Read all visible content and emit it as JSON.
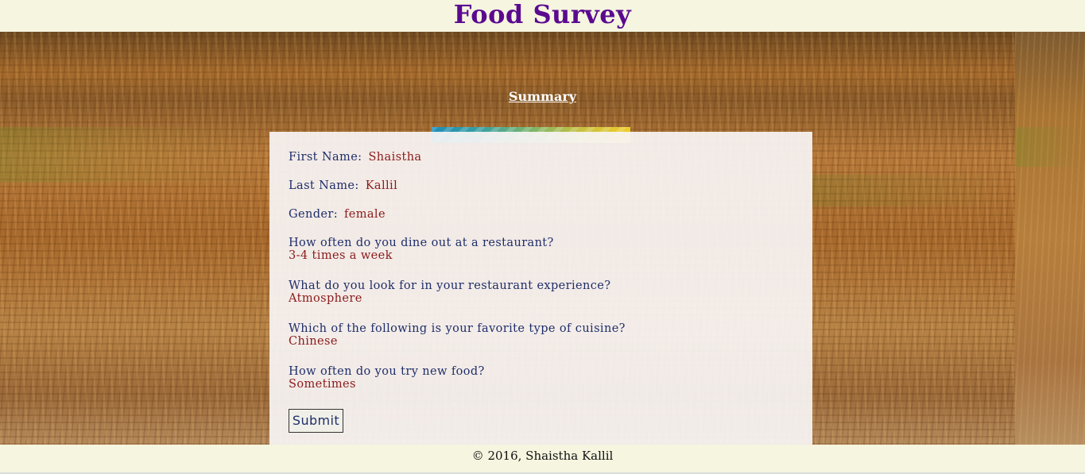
{
  "header": {
    "title": "Food Survey"
  },
  "nav": {
    "summary_label": "Summary"
  },
  "progress": {
    "fraction": 1.0,
    "colors": [
      "#1e8cb8",
      "#7ab56a",
      "#f0cc2a"
    ]
  },
  "summary": {
    "first_name": {
      "label": "First Name:",
      "value": "Shaistha"
    },
    "last_name": {
      "label": "Last Name:",
      "value": "Kallil"
    },
    "gender": {
      "label": "Gender:",
      "value": "female"
    },
    "dine_out": {
      "question": "How often do you dine out at a restaurant?",
      "answer": "3-4 times a week"
    },
    "experience": {
      "question": "What do you look for in your restaurant experience?",
      "answer": "Atmosphere"
    },
    "cuisine": {
      "question": "Which of the following is your favorite type of cuisine?",
      "answer": "Chinese"
    },
    "new_food": {
      "question": "How often do you try new food?",
      "answer": "Sometimes"
    }
  },
  "actions": {
    "submit_label": "Submit"
  },
  "footer": {
    "copyright": "© 2016, Shaistha Kallil"
  },
  "colors": {
    "title": "#5b0a8f",
    "question": "#1f2e6a",
    "answer": "#8b1a1a",
    "header_bg": "#f5f5e0"
  }
}
